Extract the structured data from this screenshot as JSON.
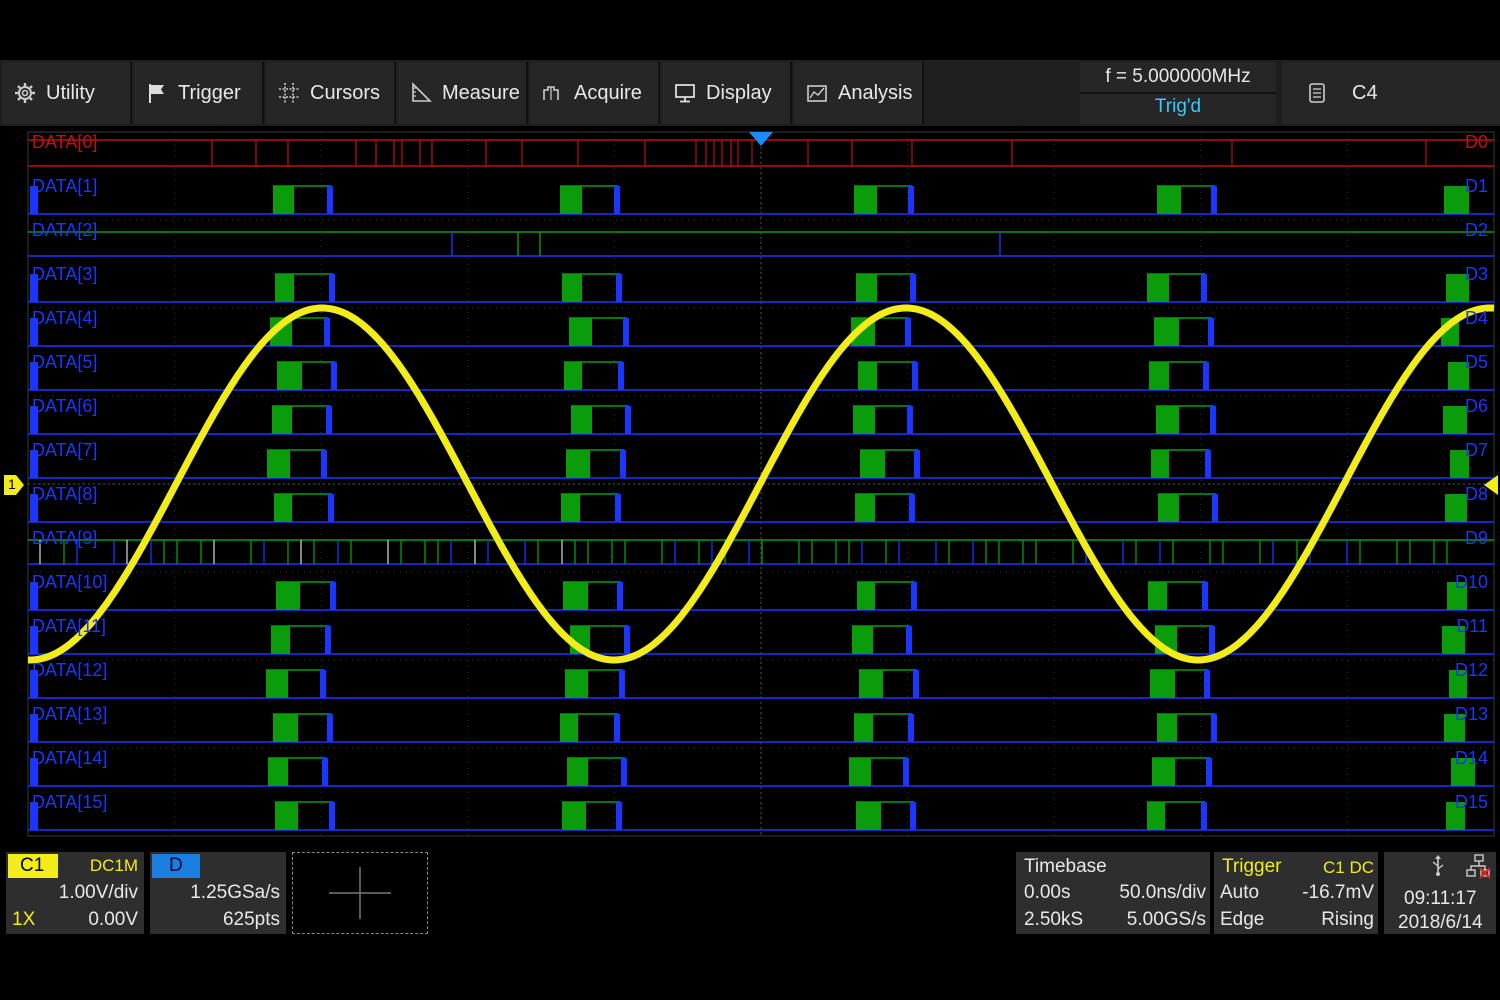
{
  "menu": {
    "items": [
      {
        "label": "Utility",
        "icon": "gear-icon"
      },
      {
        "label": "Trigger",
        "icon": "flag-icon"
      },
      {
        "label": "Cursors",
        "icon": "cursor-grid-icon"
      },
      {
        "label": "Measure",
        "icon": "measure-ruler-icon"
      },
      {
        "label": "Acquire",
        "icon": "acquire-icon"
      },
      {
        "label": "Display",
        "icon": "monitor-icon"
      },
      {
        "label": "Analysis",
        "icon": "analysis-icon"
      }
    ],
    "frequency": "f = 5.000000MHz",
    "trigger_status": "Trig'd",
    "channel": "C4"
  },
  "screen": {
    "channels": [
      {
        "left": "DATA[0]",
        "right": "D0"
      },
      {
        "left": "DATA[1]",
        "right": "D1"
      },
      {
        "left": "DATA[2]",
        "right": "D2"
      },
      {
        "left": "DATA[3]",
        "right": "D3"
      },
      {
        "left": "DATA[4]",
        "right": "D4"
      },
      {
        "left": "DATA[5]",
        "right": "D5"
      },
      {
        "left": "DATA[6]",
        "right": "D6"
      },
      {
        "left": "DATA[7]",
        "right": "D7"
      },
      {
        "left": "DATA[8]",
        "right": "D8"
      },
      {
        "left": "DATA[9]",
        "right": "D9"
      },
      {
        "left": "DATA[10]",
        "right": "D10"
      },
      {
        "left": "DATA[11]",
        "right": "D11"
      },
      {
        "left": "DATA[12]",
        "right": "D12"
      },
      {
        "left": "DATA[13]",
        "right": "D13"
      },
      {
        "left": "DATA[14]",
        "right": "D14"
      },
      {
        "left": "DATA[15]",
        "right": "D15"
      }
    ],
    "ch1_marker": "1",
    "colors": {
      "digital_label": "#1a36ff",
      "data0": "#c01010",
      "high": "#0a9c0a",
      "analog": "#f2ec1a"
    }
  },
  "bottom": {
    "c1": {
      "name": "C1",
      "coupling": "DC1M",
      "scale": "1.00V/div",
      "probe": "1X",
      "offset": "0.00V"
    },
    "digital": {
      "name": "D",
      "rate": "1.25GSa/s",
      "points": "625pts"
    },
    "timebase": {
      "title": "Timebase",
      "delay": "0.00s",
      "scale": "50.0ns/div",
      "depth": "2.50kS",
      "rate": "5.00GS/s"
    },
    "trigger": {
      "title": "Trigger",
      "source": "C1 DC",
      "mode": "Auto",
      "level": "-16.7mV",
      "type": "Edge",
      "slope": "Rising"
    },
    "clock": {
      "time": "09:11:17",
      "date": "2018/6/14"
    }
  }
}
